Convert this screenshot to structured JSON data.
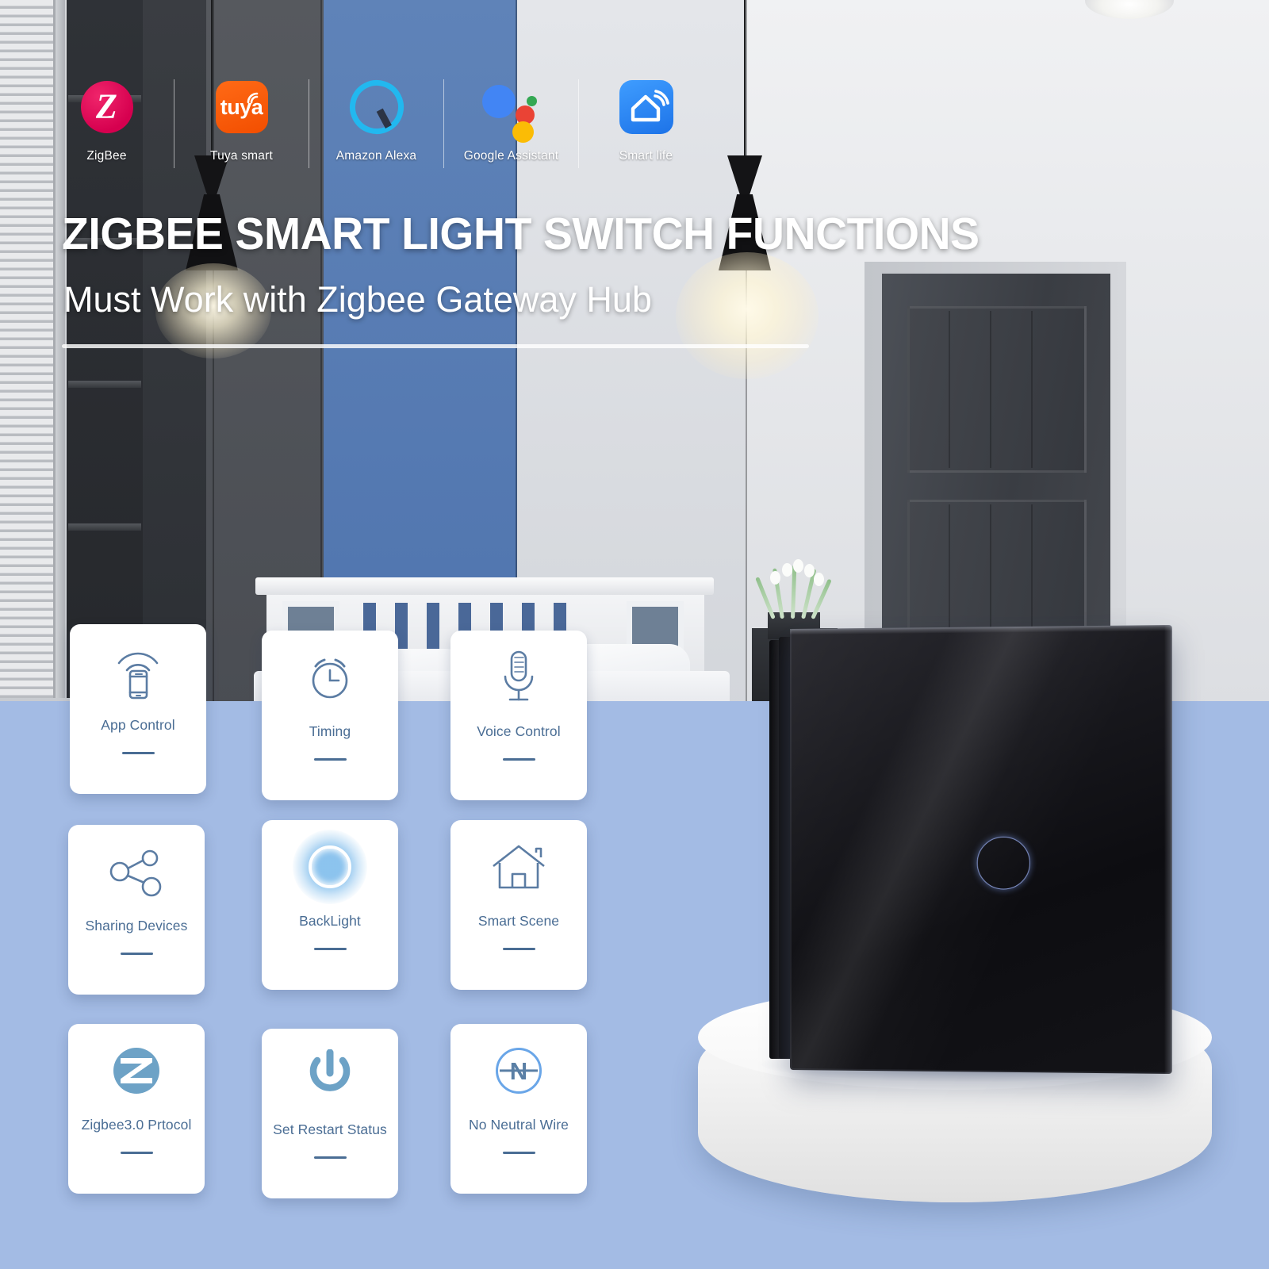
{
  "brands": [
    {
      "label": "ZigBee",
      "icon": "zigbee-logo-icon"
    },
    {
      "label": "Tuya smart",
      "icon": "tuya-logo-icon",
      "wordmark": "tuya"
    },
    {
      "label": "Amazon Alexa",
      "icon": "alexa-logo-icon"
    },
    {
      "label": "Google Assistant",
      "icon": "google-assistant-logo-icon"
    },
    {
      "label": "Smart life",
      "icon": "smart-life-logo-icon"
    }
  ],
  "headline": "ZIGBEE SMART LIGHT SWITCH FUNCTIONS",
  "subheadline": "Must Work with Zigbee Gateway Hub",
  "features": [
    {
      "label": "App Control",
      "icon": "phone-wifi-icon"
    },
    {
      "label": "Timing",
      "icon": "alarm-clock-icon"
    },
    {
      "label": "Voice Control",
      "icon": "microphone-icon"
    },
    {
      "label": "Sharing Devices",
      "icon": "share-nodes-icon"
    },
    {
      "label": "BackLight",
      "icon": "glowing-ring-icon"
    },
    {
      "label": "Smart Scene",
      "icon": "house-icon"
    },
    {
      "label": "Zigbee3.0 Prtocol",
      "icon": "zigbee-badge-icon"
    },
    {
      "label": "Set Restart Status",
      "icon": "power-icon"
    },
    {
      "label": "No Neutral Wire",
      "icon": "no-neutral-n-icon"
    }
  ],
  "product": {
    "name": "zigbee-smart-touch-light-switch",
    "panel_color": "#121216",
    "touch_indicator": "backlit-touch-ring"
  },
  "colors": {
    "floor_blue": "#A3BBE4",
    "icon_blue": "#5B7CA3",
    "label_blue": "#4A6D94",
    "zigbee_red": "#D6004F",
    "tuya_orange": "#F24E00",
    "alexa_cyan": "#22B8EF",
    "smartlife_blue": "#1D73E8",
    "google_blue": "#4285F4",
    "google_red": "#EA4335",
    "google_yellow": "#FBBC05",
    "google_green": "#34A853"
  }
}
